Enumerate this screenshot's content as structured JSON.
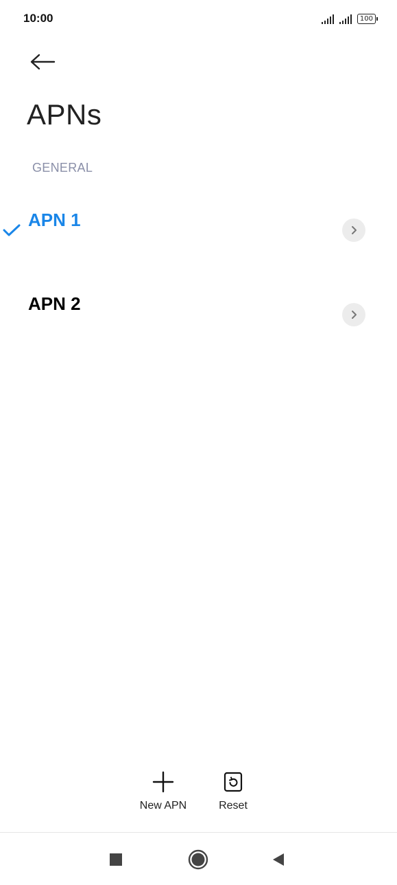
{
  "status_bar": {
    "time": "10:00",
    "battery": "100"
  },
  "header": {
    "back_icon": "arrow-left-icon",
    "title": "APNs"
  },
  "section": {
    "label": "GENERAL"
  },
  "apn_list": [
    {
      "label": "APN 1",
      "selected": true
    },
    {
      "label": "APN 2",
      "selected": false
    }
  ],
  "actions": {
    "new_apn_label": "New APN",
    "reset_label": "Reset"
  },
  "colors": {
    "accent": "#1a86e8",
    "section_header": "#8a8fa8"
  }
}
